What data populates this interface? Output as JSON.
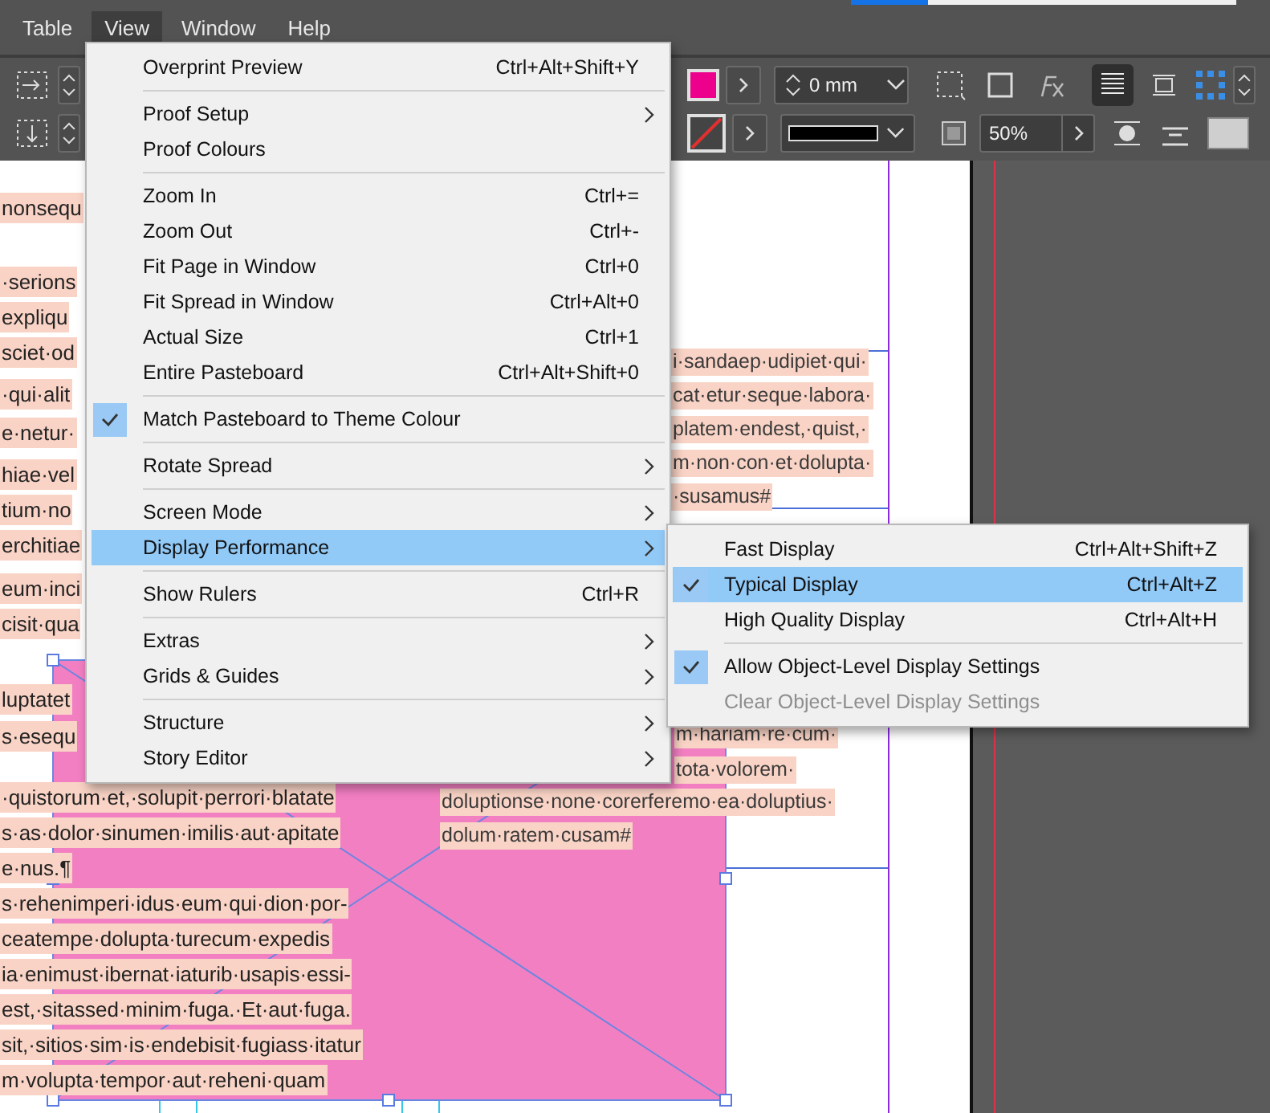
{
  "menubar": [
    {
      "label": "Table",
      "selected": false
    },
    {
      "label": "View",
      "selected": true
    },
    {
      "label": "Window",
      "selected": false
    },
    {
      "label": "Help",
      "selected": false
    }
  ],
  "toolbar": {
    "stroke_weight": "0 mm",
    "opacity": "50%"
  },
  "document": {
    "left_column": [
      "nonsequ",
      "·serions",
      "expliqu",
      "sciet·od",
      "·qui·alit",
      "e·netur·",
      "hiae·vel",
      "tium·no",
      "erchitiae",
      "eum·inci",
      "cisit·qua"
    ],
    "lower_lines": [
      "luptatet",
      "s·esequ",
      "·quistorum·et,·solupit·perrori·blatate",
      "s·as·dolor·sinumen·imilis·aut·apitate",
      "e·nus.¶",
      "s·rehenimperi·idus·eum·qui·dion·por-",
      "ceatempe·dolupta·turecum·expedis",
      "ia·enimust·ibernat·iaturib·usapis·essi-",
      "est,·sitassed·minim·fuga.·Et·aut·fuga.",
      "sit,·sitios·sim·is·endebisit·fugiass·itatur",
      "m·volupta·tempor·aut·reheni·quam"
    ],
    "right_frame": [
      "i·sandaep·udipiet·qui·",
      "cat·etur·seque·labora·",
      "platem·endest,·quist,·",
      "m·non·con·et·dolupta·",
      "·susamus#",
      "m·hariam·re·cum·",
      "tota·volorem·",
      "doluptionse·none·corerferemo·ea·doluptius·",
      "dolum·ratem·cusam#"
    ]
  },
  "view_menu": {
    "groups": [
      {
        "items": [
          {
            "label": "Overprint Preview",
            "shortcut": "Ctrl+Alt+Shift+Y",
            "checked": false,
            "selected": false,
            "submenu": false
          }
        ]
      },
      {
        "items": [
          {
            "label": "Proof Setup",
            "checked": false,
            "selected": false,
            "submenu": true
          },
          {
            "label": "Proof Colours",
            "checked": false,
            "selected": false,
            "submenu": false
          }
        ]
      },
      {
        "items": [
          {
            "label": "Zoom In",
            "shortcut": "Ctrl+=",
            "checked": false,
            "selected": false,
            "submenu": false
          },
          {
            "label": "Zoom Out",
            "shortcut": "Ctrl+-",
            "checked": false,
            "selected": false,
            "submenu": false
          },
          {
            "label": "Fit Page in Window",
            "shortcut": "Ctrl+0",
            "checked": false,
            "selected": false,
            "submenu": false
          },
          {
            "label": "Fit Spread in Window",
            "shortcut": "Ctrl+Alt+0",
            "checked": false,
            "selected": false,
            "submenu": false
          },
          {
            "label": "Actual Size",
            "shortcut": "Ctrl+1",
            "checked": false,
            "selected": false,
            "submenu": false
          },
          {
            "label": "Entire Pasteboard",
            "shortcut": "Ctrl+Alt+Shift+0",
            "checked": false,
            "selected": false,
            "submenu": false
          }
        ]
      },
      {
        "items": [
          {
            "label": "Match Pasteboard to Theme Colour",
            "checked": true,
            "selected": false,
            "submenu": false
          }
        ]
      },
      {
        "items": [
          {
            "label": "Rotate Spread",
            "checked": false,
            "selected": false,
            "submenu": true
          }
        ]
      },
      {
        "items": [
          {
            "label": "Screen Mode",
            "checked": false,
            "selected": false,
            "submenu": true
          },
          {
            "label": "Display Performance",
            "checked": false,
            "selected": true,
            "submenu": true
          }
        ]
      },
      {
        "items": [
          {
            "label": "Show Rulers",
            "shortcut": "Ctrl+R",
            "checked": false,
            "selected": false,
            "submenu": false
          }
        ]
      },
      {
        "items": [
          {
            "label": "Extras",
            "checked": false,
            "selected": false,
            "submenu": true
          },
          {
            "label": "Grids & Guides",
            "checked": false,
            "selected": false,
            "submenu": true
          }
        ]
      },
      {
        "items": [
          {
            "label": "Structure",
            "checked": false,
            "selected": false,
            "submenu": true
          },
          {
            "label": "Story Editor",
            "checked": false,
            "selected": false,
            "submenu": true
          }
        ]
      }
    ]
  },
  "display_submenu": {
    "groups": [
      {
        "items": [
          {
            "label": "Fast Display",
            "shortcut": "Ctrl+Alt+Shift+Z",
            "checked": false,
            "selected": false,
            "disabled": false
          },
          {
            "label": "Typical Display",
            "shortcut": "Ctrl+Alt+Z",
            "checked": true,
            "selected": true,
            "disabled": false
          },
          {
            "label": "High Quality Display",
            "shortcut": "Ctrl+Alt+H",
            "checked": false,
            "selected": false,
            "disabled": false
          }
        ]
      },
      {
        "items": [
          {
            "label": "Allow Object-Level Display Settings",
            "checked": true,
            "selected": false,
            "disabled": false
          },
          {
            "label": "Clear Object-Level Display Settings",
            "checked": false,
            "selected": false,
            "disabled": true
          }
        ]
      }
    ]
  }
}
